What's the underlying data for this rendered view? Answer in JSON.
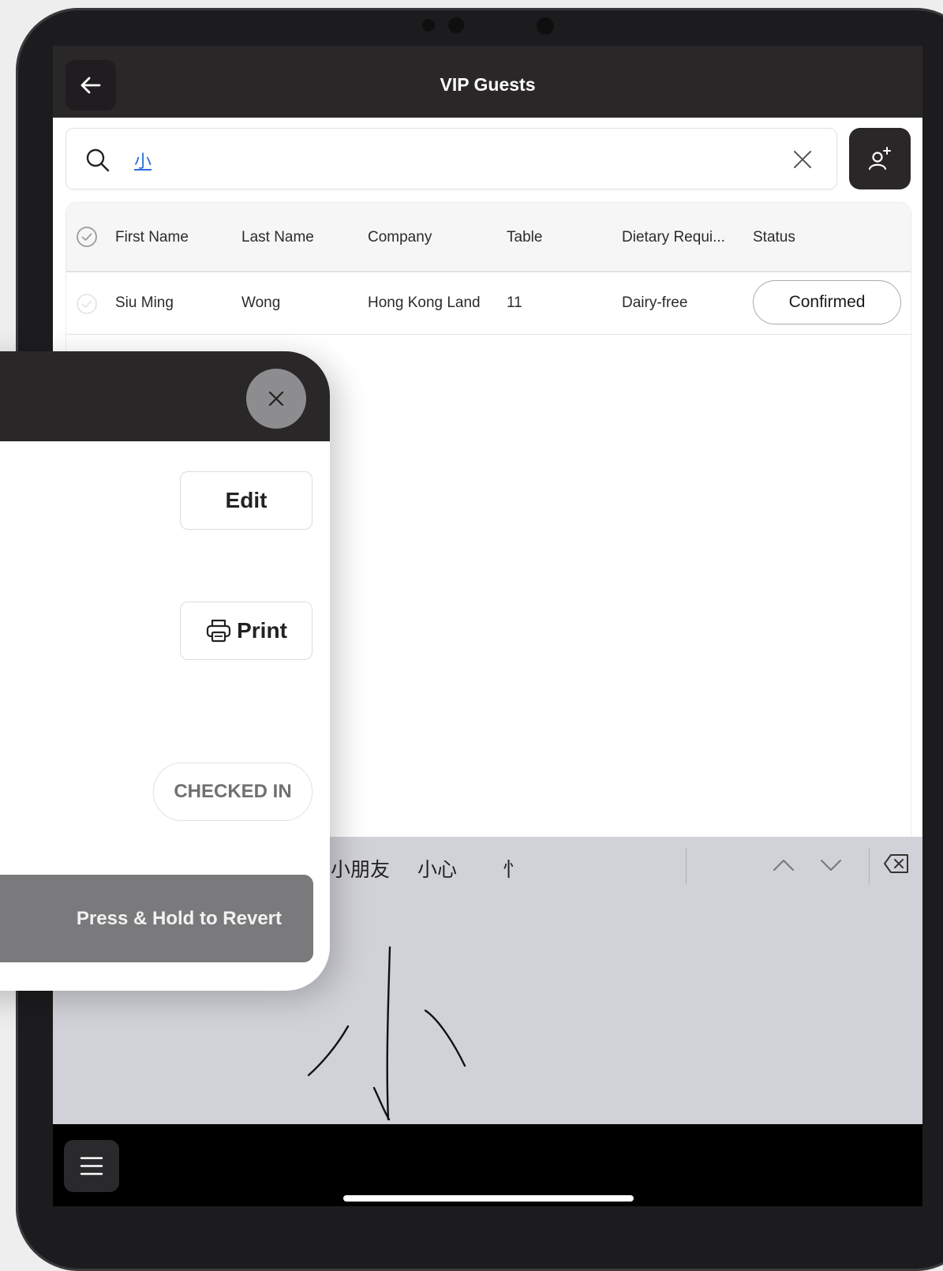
{
  "header": {
    "title": "VIP Guests"
  },
  "search": {
    "value": "小"
  },
  "table": {
    "columns": [
      "First Name",
      "Last Name",
      "Company",
      "Table",
      "Dietary Requi...",
      "Status"
    ],
    "rows": [
      {
        "first_name": "Siu Ming",
        "last_name": "Wong",
        "company": "Hong Kong Land",
        "table": "11",
        "dietary": "Dairy-free",
        "status": "Confirmed"
      }
    ]
  },
  "panel": {
    "edit_label": "Edit",
    "print_label": "Print",
    "status_label": "CHECKED IN",
    "revert_label": "Press & Hold to Revert"
  },
  "keyboard": {
    "candidates": [
      "小朋友",
      "小心",
      "忄"
    ]
  },
  "icons": [
    "back-arrow-icon",
    "search-icon",
    "clear-icon",
    "add-person-icon",
    "check-circle-icon",
    "close-icon",
    "printer-icon",
    "chevron-up-icon",
    "chevron-down-icon",
    "delete-key-icon",
    "menu-icon"
  ],
  "colors": {
    "nav_bg": "#2a2729",
    "keyboard_bg": "#d1d2d8",
    "revert_bg": "#7a7a7c"
  }
}
